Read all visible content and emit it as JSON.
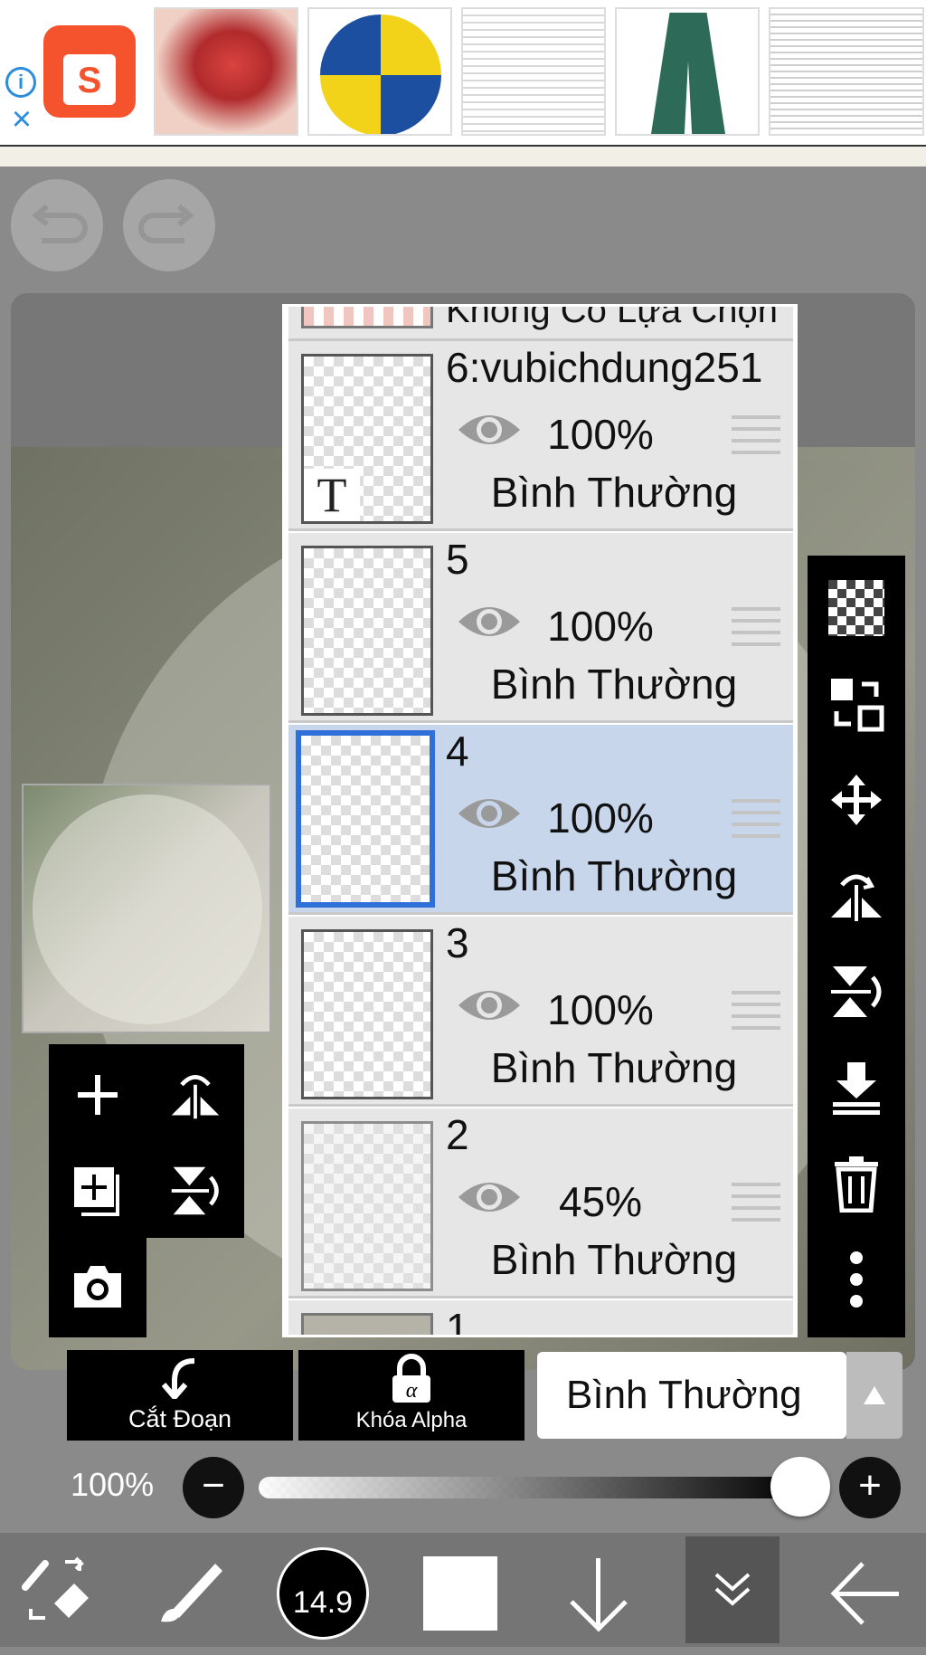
{
  "ad": {
    "info_icon": "info-icon",
    "close_icon": "close-icon",
    "shop_icon": "shopee-bag-icon"
  },
  "layers": {
    "top_partial_label": "Không Có Lựa Chọn",
    "items": [
      {
        "name": "6:vubichdung251",
        "opacity": "100%",
        "blend": "Bình Thường",
        "has_text_icon": true,
        "selected": false
      },
      {
        "name": "5",
        "opacity": "100%",
        "blend": "Bình Thường",
        "selected": false
      },
      {
        "name": "4",
        "opacity": "100%",
        "blend": "Bình Thường",
        "selected": true
      },
      {
        "name": "3",
        "opacity": "100%",
        "blend": "Bình Thường",
        "selected": false
      },
      {
        "name": "2",
        "opacity": "45%",
        "blend": "Bình Thường",
        "selected": false
      }
    ],
    "bottom_partial_label": "1"
  },
  "controls": {
    "clip_label": "Cắt Đoạn",
    "alpha_lock_label": "Khóa Alpha",
    "blend_mode": "Bình Thường",
    "opacity_label": "100%",
    "opacity_value": 1.0
  },
  "bottom": {
    "brush_size": "14.9"
  },
  "colors": {
    "selected_layer_bg": "#c7d6ea",
    "selected_border": "#2f6fd8",
    "toolbar_bg": "#000000"
  }
}
